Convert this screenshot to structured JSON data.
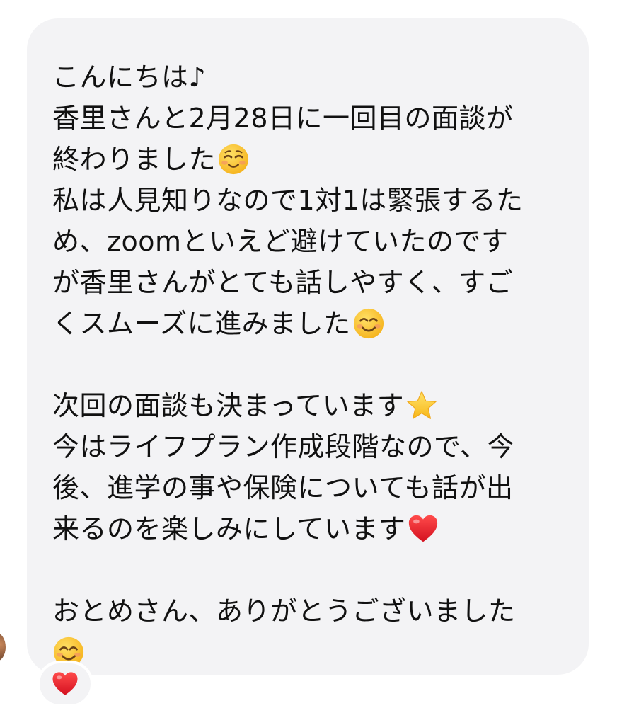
{
  "message": {
    "lines": [
      "こんにちは♪",
      "香里さんと2月28日に一回目の面談が",
      "終わりました",
      "私は人見知りなので1対1は緊張するた",
      "め、zoomといえど避けていたのです",
      "が香里さんがとても話しやすく、すご",
      "くスムーズに進みました",
      "",
      "次回の面談も決まっています",
      "今はライフプラン作成段階なので、今",
      "後、進学の事や保険についても話が出",
      "来るのを楽しみにしています",
      "",
      "おとめさん、ありがとうございました",
      ""
    ],
    "emojis": {
      "line2": "relieved-face-emoji",
      "line6": "smiling-face-emoji",
      "line8": "star-emoji",
      "line11": "red-heart-emoji",
      "line14": "smiling-face-emoji"
    }
  },
  "reaction": {
    "icon": "red-heart-emoji"
  },
  "colors": {
    "bubble": "#f3f3f5",
    "text": "#111111",
    "heart": "#e0192b",
    "star": "#ffcc33",
    "face": "#ffc83d"
  }
}
